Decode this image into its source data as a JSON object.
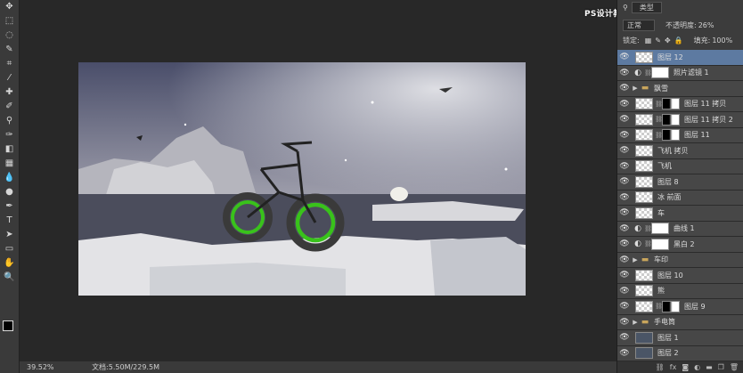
{
  "toolbar": {
    "tools": [
      "move-tool",
      "marquee-tool",
      "lasso-tool",
      "quick-select-tool",
      "crop-tool",
      "eyedropper-tool",
      "spot-heal-tool",
      "brush-tool",
      "clone-stamp-tool",
      "history-brush-tool",
      "eraser-tool",
      "gradient-tool",
      "blur-tool",
      "dodge-tool",
      "pen-tool",
      "type-tool",
      "path-select-tool",
      "rectangle-tool",
      "hand-tool",
      "zoom-tool"
    ]
  },
  "status": {
    "zoom": "39.52%",
    "doc": "文档:5.50M/229.5M"
  },
  "watermark": "PS设计教程网 WWW.MISSYUAN.NET",
  "panel": {
    "filter_label": "类型",
    "blend_mode": "正常",
    "opacity_label": "不透明度:",
    "opacity_value": "26%",
    "lock_label": "锁定:",
    "fill_label": "填充:",
    "fill_value": "100%"
  },
  "layers": [
    {
      "name": "图层 12",
      "kind": "pixel",
      "active": true
    },
    {
      "name": "照片滤镜 1",
      "kind": "adjust"
    },
    {
      "name": "飘雪",
      "kind": "group"
    },
    {
      "name": "图层 11 拷贝",
      "kind": "mask"
    },
    {
      "name": "图层 11 拷贝 2",
      "kind": "mask"
    },
    {
      "name": "图层 11",
      "kind": "mask"
    },
    {
      "name": "飞机 拷贝",
      "kind": "pixel"
    },
    {
      "name": "飞机",
      "kind": "pixel"
    },
    {
      "name": "图层 8",
      "kind": "pixel"
    },
    {
      "name": "冰 前面",
      "kind": "pixel"
    },
    {
      "name": "车",
      "kind": "pixel"
    },
    {
      "name": "曲线 1",
      "kind": "adjust"
    },
    {
      "name": "黑白 2",
      "kind": "adjust"
    },
    {
      "name": "车印",
      "kind": "group"
    },
    {
      "name": "图层 10",
      "kind": "pixel"
    },
    {
      "name": "熊",
      "kind": "pixel"
    },
    {
      "name": "图层 9",
      "kind": "mask"
    },
    {
      "name": "手电筒",
      "kind": "group"
    },
    {
      "name": "图层 1",
      "kind": "dark"
    },
    {
      "name": "图层 2",
      "kind": "dark"
    }
  ]
}
